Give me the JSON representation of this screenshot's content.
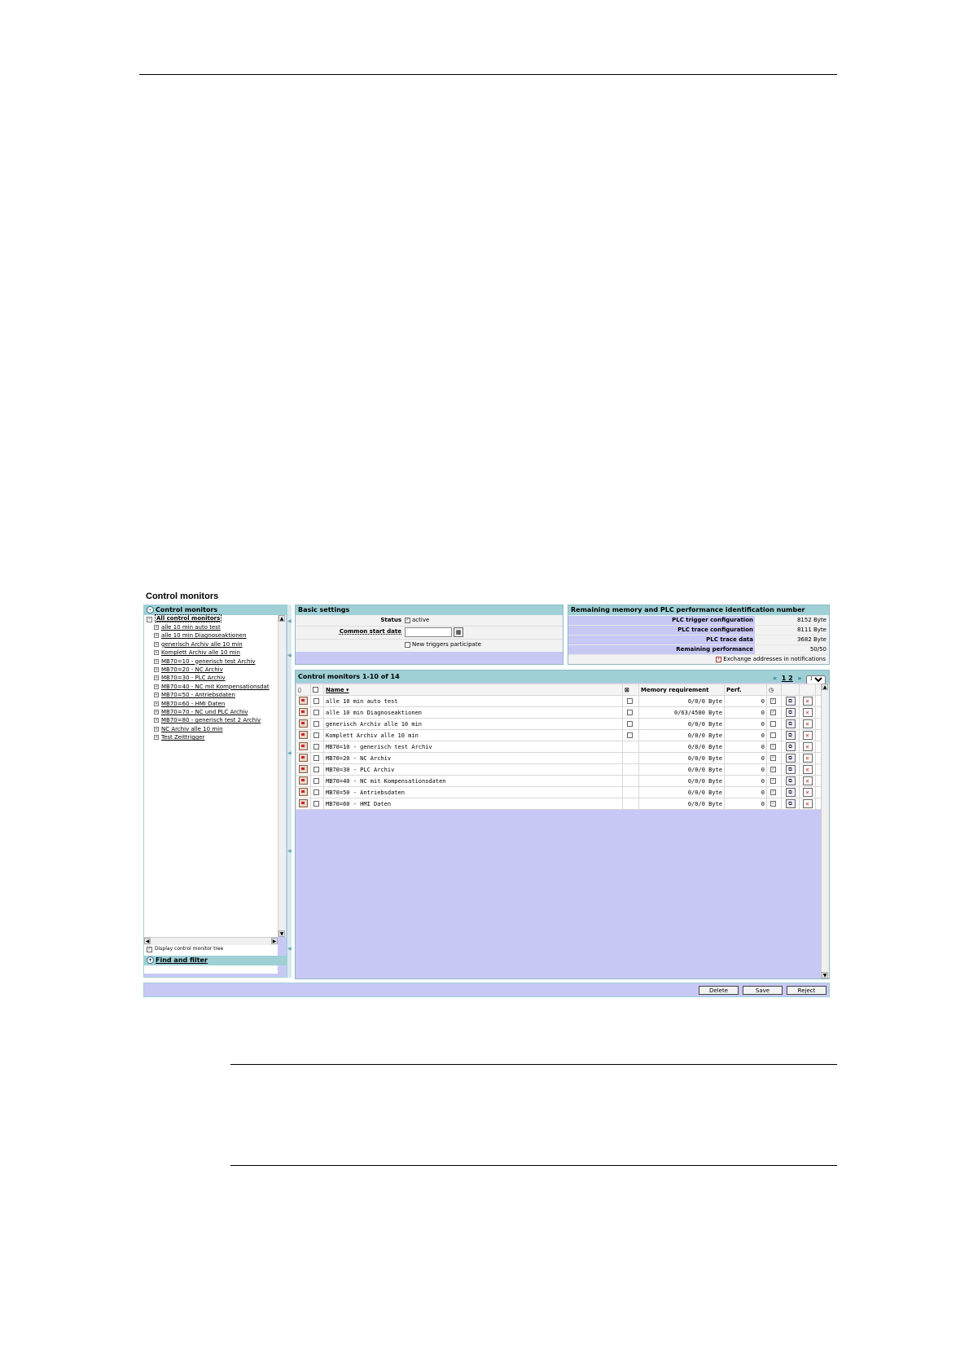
{
  "page": {
    "title": "Control monitors"
  },
  "tree": {
    "header": "Control monitors",
    "root_label": "All control monitors",
    "items": [
      "alle 10 min auto test",
      "alle 10 min Diagnoseaktionen",
      "generisch Archiv alle 10 min",
      "Komplett Archiv alle 10 min",
      "MB70=10 - generisch test Archiv",
      "MB70=20 - NC Archiv",
      "MB70=30 - PLC Archiv",
      "MB70=40 - NC mit Kompensationsdat",
      "MB70=50 - Antriebsdaten",
      "MB70=60 - HMI Daten",
      "MB70=70 - NC und PLC Archiv",
      "MB70=80 - generisch test 2 Archiv",
      "NC Archiv alle 10 min",
      "Test Zeittrigger"
    ],
    "display_checkbox_label": "Display control monitor tree",
    "find_filter_label": "Find and filter"
  },
  "basic_settings": {
    "header": "Basic settings",
    "status_label": "Status",
    "status_value": "active",
    "start_date_label": "Common start date",
    "new_triggers_label": "New triggers participate"
  },
  "memory": {
    "header": "Remaining memory and PLC performance identification number",
    "rows": [
      {
        "label": "PLC trigger configuration",
        "value": "8152 Byte"
      },
      {
        "label": "PLC trace configuration",
        "value": "8111 Byte"
      },
      {
        "label": "PLC trace data",
        "value": "3682 Byte"
      },
      {
        "label": "Remaining performance",
        "value": "50/50"
      }
    ],
    "exchange_note": "Exchange addresses in notifications"
  },
  "list": {
    "header": "Control monitors 1-10 of 14",
    "pager_pages": "1 2",
    "page_size": "10",
    "columns": {
      "name": "Name",
      "memory": "Memory requirement",
      "perf": "Perf."
    },
    "rows": [
      {
        "name": "alle 10 min auto test",
        "flag": false,
        "memory": "0/0/0 Byte",
        "perf": "0",
        "active": true
      },
      {
        "name": "alle 10 min Diagnoseaktionen",
        "flag": false,
        "memory": "0/63/4500 Byte",
        "perf": "0",
        "active": true
      },
      {
        "name": "generisch Archiv alle 10 min",
        "flag": false,
        "memory": "0/0/0 Byte",
        "perf": "0",
        "active": false
      },
      {
        "name": "Komplett Archiv alle 10 min",
        "flag": false,
        "memory": "0/0/0 Byte",
        "perf": "0",
        "active": false
      },
      {
        "name": "MB70=10 - generisch test Archiv",
        "flag": null,
        "memory": "0/0/0 Byte",
        "perf": "0",
        "active": true
      },
      {
        "name": "MB70=20 - NC Archiv",
        "flag": null,
        "memory": "0/0/0 Byte",
        "perf": "0",
        "active": true
      },
      {
        "name": "MB70=30 - PLC Archiv",
        "flag": null,
        "memory": "0/0/0 Byte",
        "perf": "0",
        "active": true
      },
      {
        "name": "MB70=40 - NC mit Kompensationsdaten",
        "flag": null,
        "memory": "0/0/0 Byte",
        "perf": "0",
        "active": true
      },
      {
        "name": "MB70=50 - Antriebsdaten",
        "flag": null,
        "memory": "0/0/0 Byte",
        "perf": "0",
        "active": true
      },
      {
        "name": "MB70=60 - HMI Daten",
        "flag": null,
        "memory": "0/0/0 Byte",
        "perf": "0",
        "active": true
      }
    ]
  },
  "buttons": {
    "delete": "Delete",
    "save": "Save",
    "reject": "Reject"
  }
}
